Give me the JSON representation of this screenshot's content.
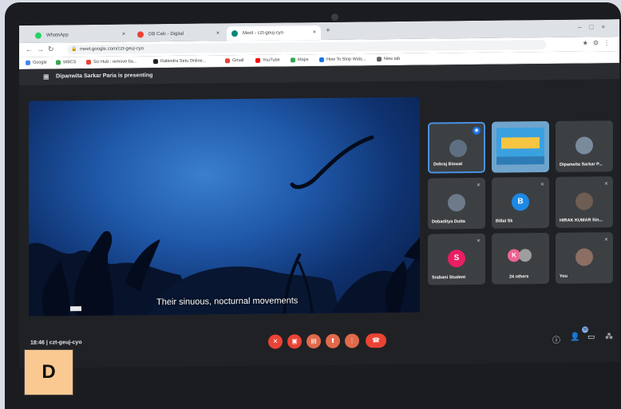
{
  "browser": {
    "tabs": [
      {
        "title": "WhatsApp",
        "favicon_color": "#25d366",
        "active": false
      },
      {
        "title": "DB Calc - Digital",
        "favicon_color": "#ea4335",
        "active": false
      },
      {
        "title": "Meet - czt-geuj-cyo",
        "favicon_color": "#00897b",
        "active": true
      }
    ],
    "address": "meet.google.com/czt-geuj-cyo",
    "bookmarks": [
      {
        "label": "Google",
        "color": "#4285f4"
      },
      {
        "label": "WBCS",
        "color": "#34a853"
      },
      {
        "label": "Sci Hub : remove ba...",
        "color": "#ea4335"
      },
      {
        "label": "Rabindra Setu Online...",
        "color": "#202124"
      },
      {
        "label": "Gmail",
        "color": "#ea4335"
      },
      {
        "label": "YouTube",
        "color": "#ff0000"
      },
      {
        "label": "Maps",
        "color": "#34a853"
      },
      {
        "label": "How To Stop Wats...",
        "color": "#1a73e8"
      },
      {
        "label": "New tab",
        "color": "#5f6368"
      }
    ]
  },
  "meet": {
    "presenting": "Dipanwita Sarkar Paria is presenting",
    "caption": "Their sinuous, nocturnal movements",
    "meeting_info": "18:46  |  czt-geuj-cyo",
    "participants": [
      {
        "name": "Debraj Biswal",
        "avatar_color": "#5d6f80",
        "initial": "",
        "speaking": true
      },
      {
        "name": "Dipanwita Sarkar P...",
        "avatar_color": "#7b8b9e",
        "initial": "",
        "speaking": false
      },
      {
        "name": "Debaditya Dutta",
        "avatar_color": "#6c7a89",
        "initial": "",
        "speaking": false
      },
      {
        "name": "Billal Sk",
        "avatar_color": "#1e88e5",
        "initial": "B",
        "speaking": false
      },
      {
        "name": "HIRAK KUMAR Sin...",
        "avatar_color": "#6d5d52",
        "initial": "",
        "speaking": false
      },
      {
        "name": "Srabani Student",
        "avatar_color": "#e91e63",
        "initial": "S",
        "speaking": false
      },
      {
        "name": "24 others",
        "avatar_color": "#f06292",
        "initial": "K",
        "speaking": false
      },
      {
        "name": "You",
        "avatar_color": "#8d6e63",
        "initial": "",
        "speaking": false
      }
    ],
    "people_count": "30"
  },
  "label": "D",
  "colors": {
    "meet_bg": "#202124",
    "tile_bg": "#3c4043",
    "end_call": "#ea4335",
    "label_bg": "#f9c991"
  }
}
